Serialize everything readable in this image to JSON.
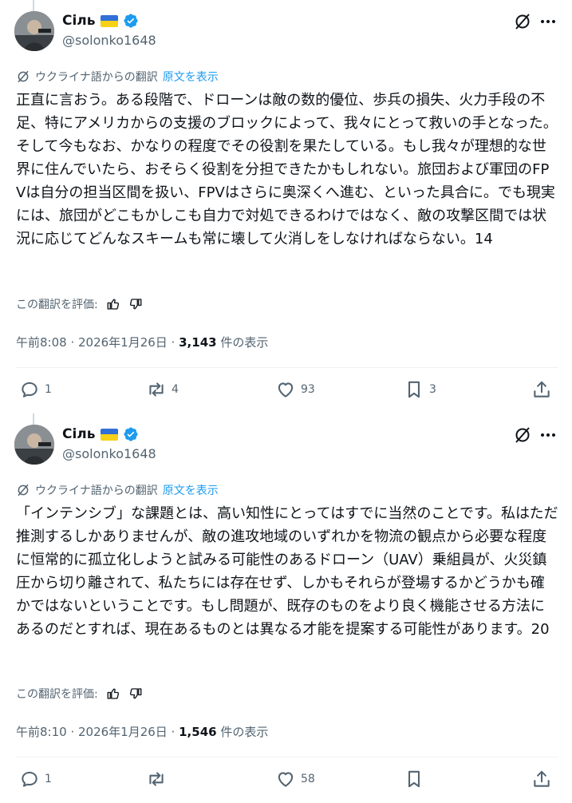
{
  "tweets": [
    {
      "author": {
        "name": "Сіль",
        "handle": "@solonko1648"
      },
      "translation": {
        "label": "ウクライナ語からの翻訳",
        "show_original": "原文を表示"
      },
      "text": "正直に言おう。ある段階で、ドローンは敵の数的優位、歩兵の損失、火力手段の不足、特にアメリカからの支援のブロックによって、我々にとって救いの手となった。そして今もなお、かなりの程度でその役割を果たしている。もし我々が理想的な世界に住んでいたら、おそらく役割を分担できたかもしれない。旅団および軍団のFPVは自分の担当区間を扱い、FPVはさらに奥深くへ進む、といった具合に。でも現実には、旅団がどこもかしこも自力で対処できるわけではなく、敵の攻撃区間では状況に応じてどんなスキームも常に壊して火消しをしなければならない。14",
      "rate_label": "この翻訳を評価:",
      "time": "午前8:08 · 2026年1月26日 ·",
      "views_count": "3,143",
      "views_label": "件の表示",
      "stats": {
        "replies": "1",
        "reposts": "4",
        "likes": "93",
        "bookmarks": "3"
      }
    },
    {
      "author": {
        "name": "Сіль",
        "handle": "@solonko1648"
      },
      "translation": {
        "label": "ウクライナ語からの翻訳",
        "show_original": "原文を表示"
      },
      "text": "「インテンシブ」な課題とは、高い知性にとってはすでに当然のことです。私はただ推測するしかありませんが、敵の進攻地域のいずれかを物流の観点から必要な程度に恒常的に孤立化しようと試みる可能性のあるドローン（UAV）乗組員が、火災鎮圧から切り離されて、私たちには存在せず、しかもそれらが登場するかどうかも確かではないということです。もし問題が、既存のものをより良く機能させる方法にあるのだとすれば、現在あるものとは異なる才能を提案する可能性があります。20",
      "rate_label": "この翻訳を評価:",
      "time": "午前8:10 · 2026年1月26日 ·",
      "views_count": "1,546",
      "views_label": "件の表示",
      "stats": {
        "replies": "1",
        "reposts": "",
        "likes": "58",
        "bookmarks": ""
      }
    }
  ],
  "icons": {
    "verified": "verified-badge-icon",
    "flag": "ukraine-flag-icon",
    "grok": "grok-icon",
    "more": "more-icon",
    "translate": "translate-icon",
    "thumbs_up": "thumbs-up-icon",
    "thumbs_down": "thumbs-down-icon",
    "reply": "reply-icon",
    "repost": "repost-icon",
    "like": "like-icon",
    "bookmark": "bookmark-icon",
    "share": "share-icon"
  },
  "colors": {
    "accent": "#1d9bf0",
    "text": "#0f1419",
    "secondary": "#536471",
    "divider": "#eff3f4"
  }
}
